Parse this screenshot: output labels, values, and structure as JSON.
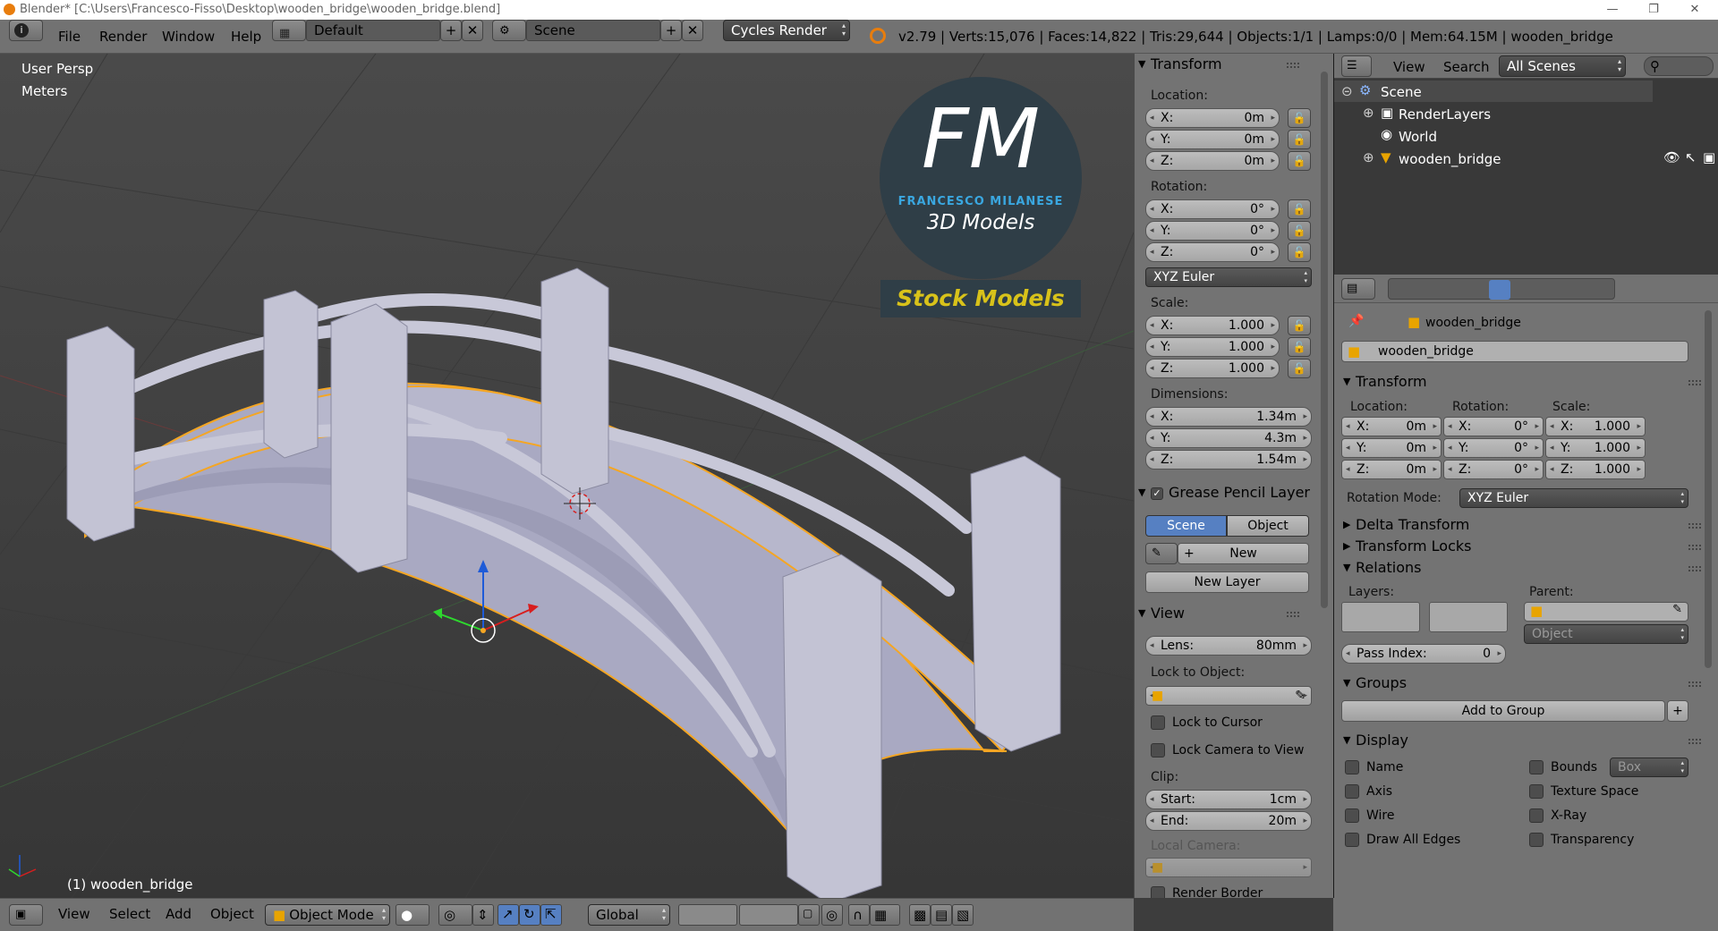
{
  "titlebar": {
    "text": "Blender* [C:\\Users\\Francesco-Fisso\\Desktop\\wooden_bridge\\wooden_bridge.blend]"
  },
  "menu": {
    "file": "File",
    "render": "Render",
    "window": "Window",
    "help": "Help"
  },
  "layout": {
    "value": "Default"
  },
  "scene": {
    "value": "Scene"
  },
  "engine": {
    "value": "Cycles Render"
  },
  "stats": "v2.79 | Verts:15,076 | Faces:14,822 | Tris:29,644 | Objects:1/1 | Lamps:0/0 | Mem:64.15M | wooden_bridge",
  "viewport": {
    "persp": "User Persp",
    "units": "Meters",
    "object_label": "(1) wooden_bridge",
    "logo": {
      "initials": "FM",
      "name": "FRANCESCO MILANESE",
      "tagline": "3D Models",
      "banner": "Stock Models"
    }
  },
  "npanel": {
    "transform_title": "Transform",
    "location_label": "Location:",
    "location": [
      {
        "k": "X:",
        "v": "0m"
      },
      {
        "k": "Y:",
        "v": "0m"
      },
      {
        "k": "Z:",
        "v": "0m"
      }
    ],
    "rotation_label": "Rotation:",
    "rotation": [
      {
        "k": "X:",
        "v": "0°"
      },
      {
        "k": "Y:",
        "v": "0°"
      },
      {
        "k": "Z:",
        "v": "0°"
      }
    ],
    "rotation_mode": "XYZ Euler",
    "scale_label": "Scale:",
    "scale": [
      {
        "k": "X:",
        "v": "1.000"
      },
      {
        "k": "Y:",
        "v": "1.000"
      },
      {
        "k": "Z:",
        "v": "1.000"
      }
    ],
    "dimensions_label": "Dimensions:",
    "dimensions": [
      {
        "k": "X:",
        "v": "1.34m"
      },
      {
        "k": "Y:",
        "v": "4.3m"
      },
      {
        "k": "Z:",
        "v": "1.54m"
      }
    ],
    "grease_title": "Grease Pencil Layer",
    "grease_scene": "Scene",
    "grease_object": "Object",
    "grease_new": "New",
    "grease_new_layer": "New Layer",
    "view_title": "View",
    "lens": {
      "k": "Lens:",
      "v": "80mm"
    },
    "lock_to_object": "Lock to Object:",
    "lock_cursor": "Lock to Cursor",
    "lock_camera": "Lock Camera to View",
    "clip_label": "Clip:",
    "clip_start": {
      "k": "Start:",
      "v": "1cm"
    },
    "clip_end": {
      "k": "End:",
      "v": "20m"
    },
    "local_camera": "Local Camera:",
    "render_border": "Render Border"
  },
  "outliner": {
    "view": "View",
    "search": "Search",
    "filter": "All Scenes",
    "items": [
      "Scene",
      "RenderLayers",
      "World",
      "wooden_bridge"
    ]
  },
  "properties": {
    "breadcrumb_obj": "wooden_bridge",
    "name_field": "wooden_bridge",
    "transform_title": "Transform",
    "location_label": "Location:",
    "rotation_label": "Rotation:",
    "scale_label": "Scale:",
    "location": [
      {
        "k": "X:",
        "v": "0m"
      },
      {
        "k": "Y:",
        "v": "0m"
      },
      {
        "k": "Z:",
        "v": "0m"
      }
    ],
    "rotation": [
      {
        "k": "X:",
        "v": "0°"
      },
      {
        "k": "Y:",
        "v": "0°"
      },
      {
        "k": "Z:",
        "v": "0°"
      }
    ],
    "scale": [
      {
        "k": "X:",
        "v": "1.000"
      },
      {
        "k": "Y:",
        "v": "1.000"
      },
      {
        "k": "Z:",
        "v": "1.000"
      }
    ],
    "rotation_mode_label": "Rotation Mode:",
    "rotation_mode": "XYZ Euler",
    "delta_transform": "Delta Transform",
    "transform_locks": "Transform Locks",
    "relations": "Relations",
    "layers_label": "Layers:",
    "parent_label": "Parent:",
    "parent_type": "Object",
    "pass_index": {
      "k": "Pass Index:",
      "v": "0"
    },
    "groups": "Groups",
    "add_to_group": "Add to Group",
    "display": "Display",
    "display_left": [
      "Name",
      "Axis",
      "Wire",
      "Draw All Edges"
    ],
    "display_right": [
      "Bounds",
      "Texture Space",
      "X-Ray",
      "Transparency"
    ],
    "bounds_type": "Box"
  },
  "bottombar": {
    "view": "View",
    "select": "Select",
    "add": "Add",
    "object": "Object",
    "mode": "Object Mode",
    "orientation": "Global"
  }
}
